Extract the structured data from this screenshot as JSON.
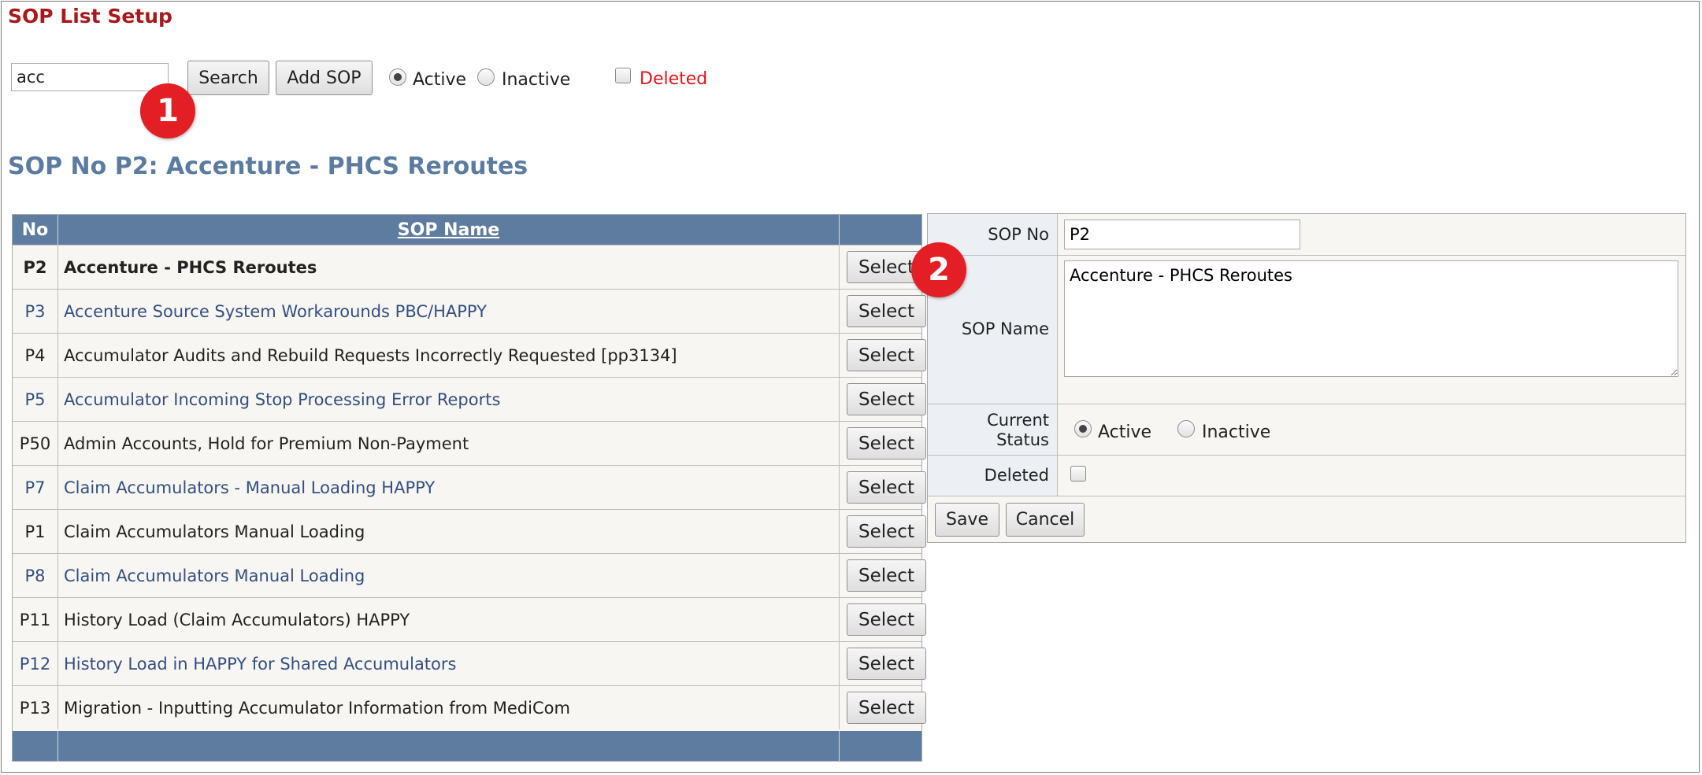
{
  "page": {
    "title": "SOP List Setup"
  },
  "toolbar": {
    "search_value": "acc",
    "search_button": "Search",
    "add_button": "Add SOP",
    "status_active": "Active",
    "status_inactive": "Inactive",
    "deleted_label": "Deleted",
    "selected_status": "Active",
    "deleted_checked": false
  },
  "annotations": {
    "badge1": "1",
    "badge2": "2"
  },
  "sop_heading": "SOP No P2: Accenture - PHCS Reroutes",
  "list": {
    "columns": {
      "no": "No",
      "name": "SOP Name"
    },
    "select_label": "Select",
    "rows": [
      {
        "no": "P2",
        "name": "Accenture - PHCS Reroutes",
        "selected": true
      },
      {
        "no": "P3",
        "name": "Accenture Source System Workarounds PBC/HAPPY"
      },
      {
        "no": "P4",
        "name": "Accumulator Audits and Rebuild Requests Incorrectly Requested [pp3134]"
      },
      {
        "no": "P5",
        "name": "Accumulator Incoming Stop Processing Error Reports"
      },
      {
        "no": "P50",
        "name": "Admin Accounts, Hold for Premium Non-Payment"
      },
      {
        "no": "P7",
        "name": "Claim Accumulators - Manual Loading HAPPY"
      },
      {
        "no": "P1",
        "name": "Claim Accumulators Manual Loading"
      },
      {
        "no": "P8",
        "name": "Claim Accumulators Manual Loading"
      },
      {
        "no": "P11",
        "name": "History Load (Claim Accumulators) HAPPY"
      },
      {
        "no": "P12",
        "name": "History Load in HAPPY for Shared Accumulators"
      },
      {
        "no": "P13",
        "name": "Migration - Inputting Accumulator Information from MediCom"
      }
    ]
  },
  "detail": {
    "sop_no_label": "SOP No",
    "sop_no_value": "P2",
    "sop_name_label": "SOP Name",
    "sop_name_value": "Accenture - PHCS Reroutes",
    "status_label_1": "Current",
    "status_label_2": "Status",
    "status_active": "Active",
    "status_inactive": "Inactive",
    "deleted_label": "Deleted",
    "save_button": "Save",
    "cancel_button": "Cancel"
  },
  "colors": {
    "title_red": "#a8191c",
    "header_blue": "#5e7ca0",
    "heading_blue": "#5b7ba1",
    "link_blue": "#334f80",
    "badge_red": "#e31e24"
  },
  "icons": {
    "badge1": "numbered-callout",
    "badge2": "numbered-callout"
  }
}
